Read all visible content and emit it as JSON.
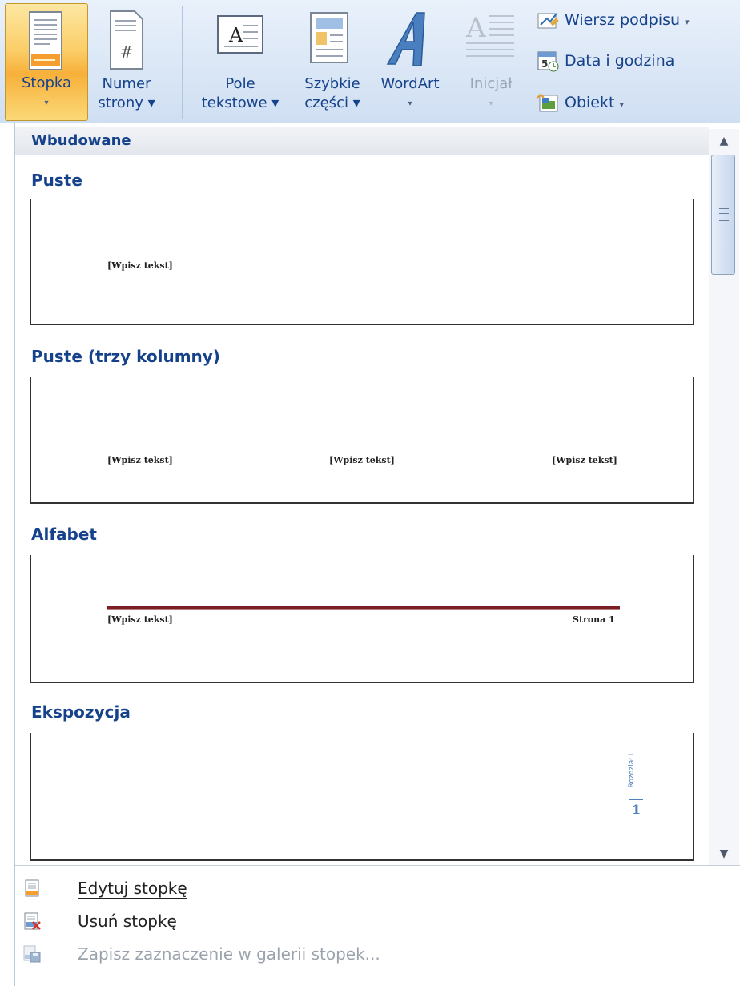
{
  "ribbon": {
    "stopka": {
      "label": "Stopka",
      "arrow": "▾"
    },
    "numer": {
      "line1": "Numer",
      "line2": "strony ▾"
    },
    "pole": {
      "line1": "Pole",
      "line2": "tekstowe ▾"
    },
    "szybkie": {
      "line1": "Szybkie",
      "line2": "części ▾"
    },
    "wordart": {
      "label": "WordArt",
      "arrow": "▾"
    },
    "inicjal": {
      "label": "Inicjał",
      "arrow": "▾"
    },
    "wiersz_podpisu": "Wiersz podpisu",
    "data_godzina": "Data i godzina",
    "obiekt": "Obiekt",
    "dropdown_arrow": "▾"
  },
  "gallery": {
    "header": "Wbudowane",
    "items": [
      {
        "title": "Puste",
        "placeholders": [
          "[Wpisz tekst]"
        ]
      },
      {
        "title": "Puste (trzy kolumny)",
        "placeholders": [
          "[Wpisz tekst]",
          "[Wpisz tekst]",
          "[Wpisz tekst]"
        ]
      },
      {
        "title": "Alfabet",
        "left_text": "[Wpisz tekst]",
        "right_text": "Strona 1",
        "rule_color": "#7a1f24"
      },
      {
        "title": "Ekspozycja",
        "vertical_text": "Rozdział I",
        "page_number": "1",
        "accent_color": "#4f81bd"
      }
    ]
  },
  "menu": {
    "edit": {
      "label": "Edytuj stopkę"
    },
    "remove": {
      "label": "Usuń stopkę"
    },
    "save": {
      "label": "Zapisz zaznaczenie w galerii stopek..."
    }
  },
  "colors": {
    "accent": "#15428b",
    "active_button": "#fbce68"
  },
  "icons": {
    "stopka": "footer-icon",
    "numer": "page-number-icon",
    "pole": "text-box-icon",
    "szybkie": "quick-parts-icon",
    "wordart": "wordart-icon",
    "inicjal": "drop-cap-icon",
    "wiersz": "signature-line-icon",
    "data": "date-time-icon",
    "obiekt": "object-icon"
  }
}
